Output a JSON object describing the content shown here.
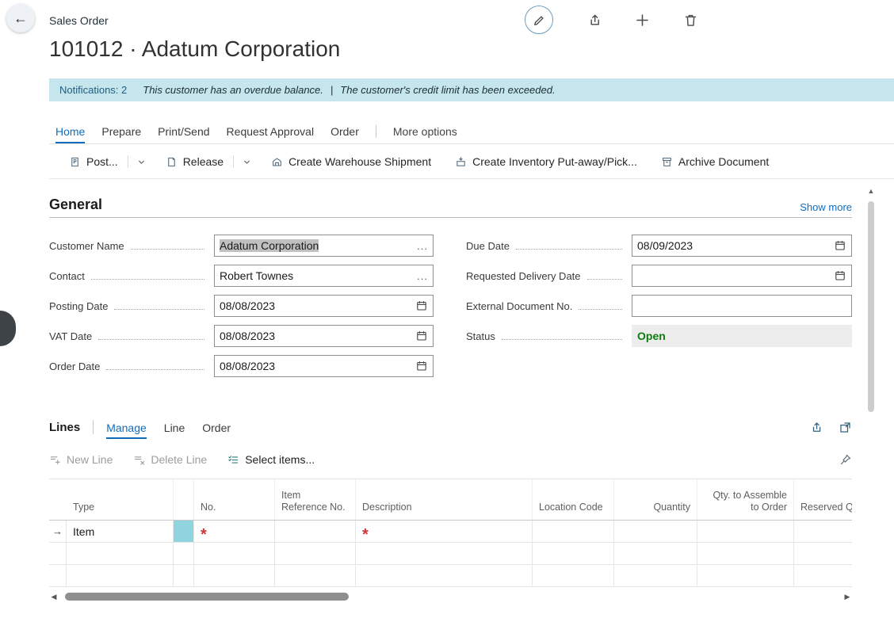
{
  "colors": {
    "accent": "#0f6cbd",
    "notification-bg": "#c4e6ec",
    "notification-label": "#235d80",
    "status-green": "#107c10",
    "required-red": "#d13438",
    "cell-highlight": "#90d4e0",
    "disabled-text": "#9d9d9d",
    "action-icon": "#4e6577",
    "scroll-thumb": "#8f8f8f"
  },
  "icons": {
    "back": "←",
    "row_arrow": "→",
    "lookup": "...",
    "scroll_up": "▲",
    "scroll_left": "◀",
    "scroll_right": "▶"
  },
  "topbar": {
    "caption": "Sales Order"
  },
  "page": {
    "title": "101012 · Adatum Corporation"
  },
  "notification": {
    "label": "Notifications: 2",
    "message1": "This customer has an overdue balance.",
    "separator": "|",
    "message2": "The customer's credit limit has been exceeded."
  },
  "menu": {
    "tabs": [
      {
        "label": "Home",
        "active": true
      },
      {
        "label": "Prepare"
      },
      {
        "label": "Print/Send"
      },
      {
        "label": "Request Approval"
      },
      {
        "label": "Order"
      }
    ],
    "more_options": "More options"
  },
  "actions": {
    "post": "Post...",
    "release": "Release",
    "create_warehouse_shipment": "Create Warehouse Shipment",
    "create_inventory_putaway_pick": "Create Inventory Put-away/Pick...",
    "archive_document": "Archive Document"
  },
  "general": {
    "heading": "General",
    "show_more": "Show more",
    "customer_name": {
      "label": "Customer Name",
      "value": "Adatum Corporation"
    },
    "contact": {
      "label": "Contact",
      "value": "Robert Townes"
    },
    "posting_date": {
      "label": "Posting Date",
      "value": "08/08/2023"
    },
    "vat_date": {
      "label": "VAT Date",
      "value": "08/08/2023"
    },
    "order_date": {
      "label": "Order Date",
      "value": "08/08/2023"
    },
    "due_date": {
      "label": "Due Date",
      "value": "08/09/2023"
    },
    "requested_delivery_date": {
      "label": "Requested Delivery Date",
      "value": ""
    },
    "external_document_no": {
      "label": "External Document No.",
      "value": ""
    },
    "status": {
      "label": "Status",
      "value": "Open"
    }
  },
  "lines": {
    "heading": "Lines",
    "tabs": [
      "Manage",
      "Line",
      "Order"
    ],
    "toolbar": {
      "new_line": "New Line",
      "delete_line": "Delete Line",
      "select_items": "Select items..."
    },
    "columns": [
      "",
      "Type",
      "",
      "No.",
      "Item Reference No.",
      "Description",
      "Location Code",
      "Quantity",
      "Qty. to Assemble to Order",
      "Reserved Qu..."
    ],
    "rows": [
      {
        "type": "Item",
        "no_marker": "*",
        "description_marker": "*"
      },
      {
        "type": ""
      },
      {
        "type": ""
      }
    ]
  }
}
